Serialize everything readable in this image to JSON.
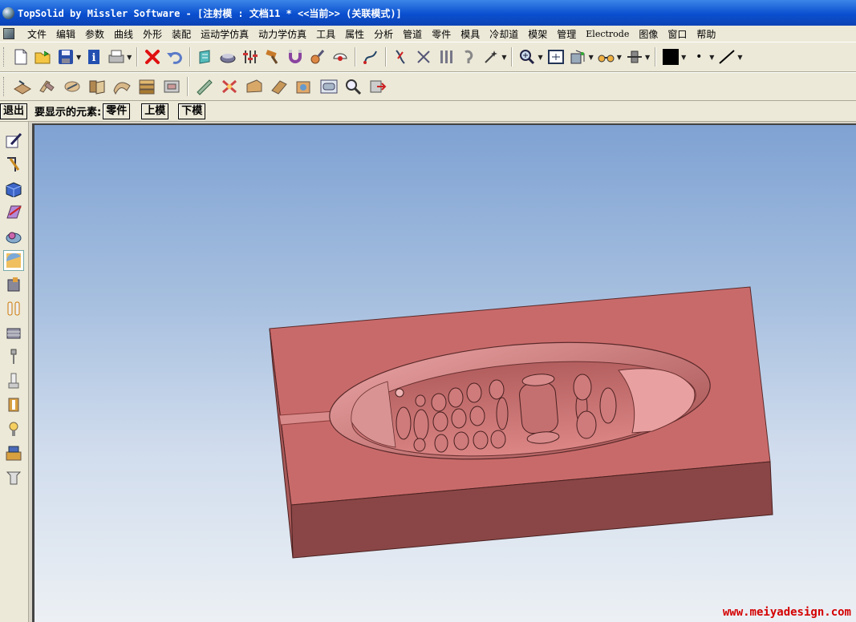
{
  "window": {
    "title": "TopSolid by Missler Software - [注射模 : 文档11 *  <<当前>> (关联模式)]"
  },
  "menu": {
    "items": [
      "文件",
      "编辑",
      "参数",
      "曲线",
      "外形",
      "装配",
      "运动学仿真",
      "动力学仿真",
      "工具",
      "属性",
      "分析",
      "管道",
      "零件",
      "模具",
      "冷却道",
      "模架",
      "管理",
      "Electrode",
      "图像",
      "窗口",
      "帮助"
    ]
  },
  "toolbar1": {
    "icons": [
      "new-file-icon",
      "open-file-icon",
      "save-icon",
      "info-icon",
      "print-icon",
      "delete-icon",
      "undo-icon",
      "layer-icon",
      "pipe-icon",
      "sliders-icon",
      "hammer-icon",
      "magnet-icon",
      "tool-icon",
      "measure-icon",
      "curve-icon",
      "intersect-icon",
      "columns-icon",
      "hook-icon",
      "wand-icon",
      "zoom-icon",
      "zoom-fit-icon",
      "view-icon",
      "glasses-icon",
      "orbit-icon",
      "color-swatch",
      "point-style",
      "line-style"
    ],
    "current_color": "#000000"
  },
  "toolbar2": {
    "icons": [
      "mold-part-icon",
      "mold-split-icon",
      "mold-core-icon",
      "mold-cavity-icon",
      "mold-surface-icon",
      "mold-stack-icon",
      "mold-frame-icon",
      "mold-shell-icon",
      "mold-tool-icon",
      "mold-slide-icon",
      "mold-lifter-icon",
      "mold-block-icon",
      "mold-view-icon",
      "mold-inspect-icon",
      "mold-export-icon"
    ]
  },
  "command_bar": {
    "exit_label": "退出",
    "prompt_label": "要显示的元素:",
    "part_label": "零件",
    "upper_mold_label": "上模",
    "lower_mold_label": "下模"
  },
  "left_toolbar": {
    "icons": [
      "sketch-icon",
      "curve-draw-icon",
      "solid-block-icon",
      "surface-icon",
      "shape-icon",
      "mold-highlight-icon",
      "component-icon",
      "parallel-icon",
      "box-icon",
      "pin-icon",
      "ejector-icon",
      "cooling-icon",
      "light-icon",
      "assembly-icon",
      "extend-icon"
    ]
  },
  "viewport": {
    "mold_color": "#c96a6a",
    "mold_side_color": "#8a4646",
    "background_top": "#7fa2d3",
    "background_bottom": "#ecf0f4"
  },
  "watermark": {
    "text": "www.meiyadesign.com"
  }
}
